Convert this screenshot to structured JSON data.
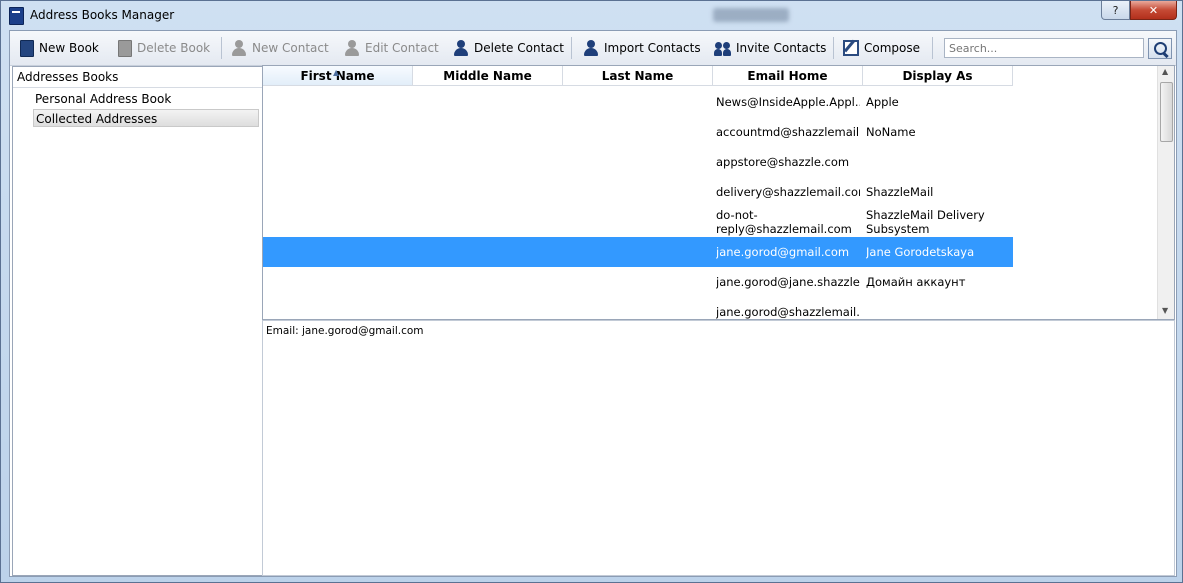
{
  "window": {
    "title": "Address Books Manager",
    "help_label": "?",
    "close_label": "✕"
  },
  "toolbar": {
    "new_book": "New Book",
    "delete_book": "Delete Book",
    "new_contact": "New Contact",
    "edit_contact": "Edit Contact",
    "delete_contact": "Delete Contact",
    "import_contacts": "Import Contacts",
    "invite_contacts": "Invite Contacts",
    "compose": "Compose",
    "search_placeholder": "Search..."
  },
  "sidebar": {
    "header": "Addresses Books",
    "items": [
      {
        "label": "Personal Address Book"
      },
      {
        "label": "Collected Addresses"
      }
    ]
  },
  "table": {
    "columns": [
      "First Name",
      "Middle Name",
      "Last Name",
      "Email Home",
      "Display As"
    ],
    "rows": [
      {
        "email": "News@InsideApple.Appl...",
        "display": "Apple"
      },
      {
        "email": "accountmd@shazzlemail....",
        "display": "NoName"
      },
      {
        "email": "appstore@shazzle.com",
        "display": ""
      },
      {
        "email": "delivery@shazzlemail.com",
        "display": "ShazzleMail"
      },
      {
        "email": "do-not-reply@shazzlemail.com",
        "display": "ShazzleMail Delivery Subsystem"
      },
      {
        "email": "jane.gorod@gmail.com",
        "display": "Jane Gorodetskaya"
      },
      {
        "email": "jane.gorod@jane.shazzle...",
        "display": "Домайн аккаунт"
      },
      {
        "email": "jane.gorod@shazzlemail....",
        "display": ""
      }
    ]
  },
  "detail": {
    "text": "Email: jane.gorod@gmail.com"
  }
}
